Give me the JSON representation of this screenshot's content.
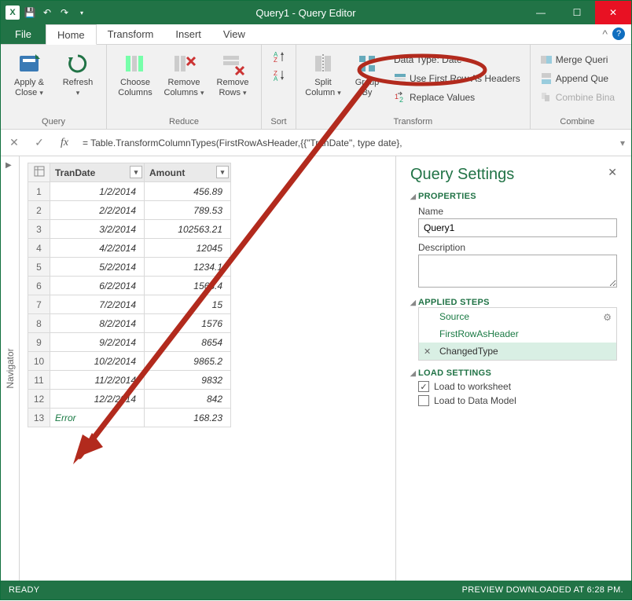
{
  "window": {
    "title": "Query1 - Query Editor",
    "qat_icons": [
      "excel",
      "save",
      "undo",
      "redo"
    ]
  },
  "tabs": {
    "file": "File",
    "items": [
      "Home",
      "Transform",
      "Insert",
      "View"
    ],
    "active": "Home"
  },
  "ribbon": {
    "query": {
      "label": "Query",
      "apply_close": "Apply &\nClose",
      "refresh": "Refresh"
    },
    "reduce": {
      "label": "Reduce",
      "choose_cols": "Choose\nColumns",
      "remove_cols": "Remove\nColumns",
      "remove_rows": "Remove\nRows"
    },
    "sort": {
      "label": "Sort"
    },
    "transform": {
      "label": "Transform",
      "split": "Split\nColumn",
      "group": "Group\nBy",
      "data_type": "Data Type: Date",
      "first_row": "Use First Row As Headers",
      "replace": "Replace Values"
    },
    "combine": {
      "label": "Combine",
      "merge": "Merge Queri",
      "append": "Append Que",
      "binaries": "Combine Bina"
    }
  },
  "formula_bar": {
    "text": "= Table.TransformColumnTypes(FirstRowAsHeader,{{\"TranDate\", type date},"
  },
  "navigator_label": "Navigator",
  "grid": {
    "columns": [
      "TranDate",
      "Amount"
    ],
    "rows": [
      {
        "n": 1,
        "date": "1/2/2014",
        "amount": "456.89"
      },
      {
        "n": 2,
        "date": "2/2/2014",
        "amount": "789.53"
      },
      {
        "n": 3,
        "date": "3/2/2014",
        "amount": "102563.21"
      },
      {
        "n": 4,
        "date": "4/2/2014",
        "amount": "12045"
      },
      {
        "n": 5,
        "date": "5/2/2014",
        "amount": "1234.1"
      },
      {
        "n": 6,
        "date": "6/2/2014",
        "amount": "1568.4"
      },
      {
        "n": 7,
        "date": "7/2/2014",
        "amount": "15"
      },
      {
        "n": 8,
        "date": "8/2/2014",
        "amount": "1576"
      },
      {
        "n": 9,
        "date": "9/2/2014",
        "amount": "8654"
      },
      {
        "n": 10,
        "date": "10/2/2014",
        "amount": "9865.2"
      },
      {
        "n": 11,
        "date": "11/2/2014",
        "amount": "9832"
      },
      {
        "n": 12,
        "date": "12/2/2014",
        "amount": "842"
      },
      {
        "n": 13,
        "date": "Error",
        "amount": "168.23",
        "is_error": true
      }
    ]
  },
  "settings": {
    "title": "Query Settings",
    "properties_label": "PROPERTIES",
    "name_label": "Name",
    "name_value": "Query1",
    "desc_label": "Description",
    "desc_value": "",
    "steps_label": "APPLIED STEPS",
    "steps": [
      {
        "name": "Source",
        "gear": true
      },
      {
        "name": "FirstRowAsHeader"
      },
      {
        "name": "ChangedType",
        "selected": true,
        "deletable": true
      }
    ],
    "load_label": "LOAD SETTINGS",
    "load_worksheet": "Load to worksheet",
    "load_worksheet_checked": true,
    "load_model": "Load to Data Model",
    "load_model_checked": false
  },
  "status": {
    "left": "READY",
    "right": "PREVIEW DOWNLOADED AT 6:28 PM."
  }
}
